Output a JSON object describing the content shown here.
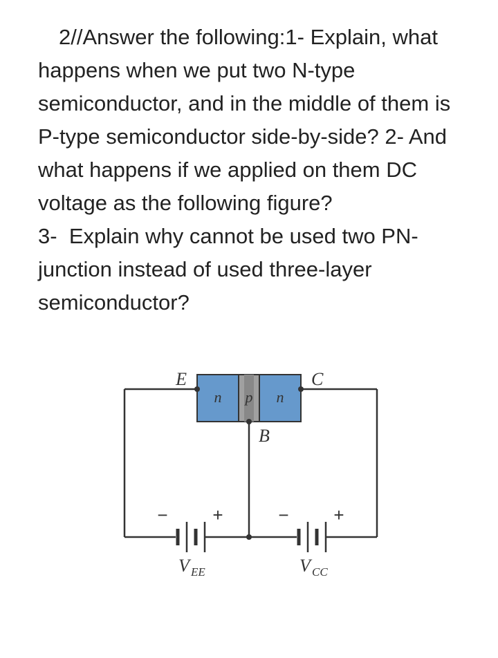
{
  "question": {
    "prefix": "2//Answer the following:1- ",
    "part1": "Explain, what happens when we put two N-type semiconductor, and in the middle of them is P-type semiconductor side-by-side? 2- And what happens if we applied on them DC voltage as the following figure?",
    "part3_prefix": "3- ",
    "part3": "Explain why cannot be used two PN-junction instead of used three-layer semiconductor?"
  },
  "diagram": {
    "emitter_label": "E",
    "collector_label": "C",
    "base_label": "B",
    "region_left": "n",
    "region_mid": "p",
    "region_right": "n",
    "vee_label": "V",
    "vee_sub": "EE",
    "vcc_label": "V",
    "vcc_sub": "CC",
    "plus": "+",
    "minus": "−"
  },
  "colors": {
    "n_region": "#6699cc",
    "p_region": "#a0a0a0",
    "wire": "#333333",
    "label": "#333333"
  }
}
